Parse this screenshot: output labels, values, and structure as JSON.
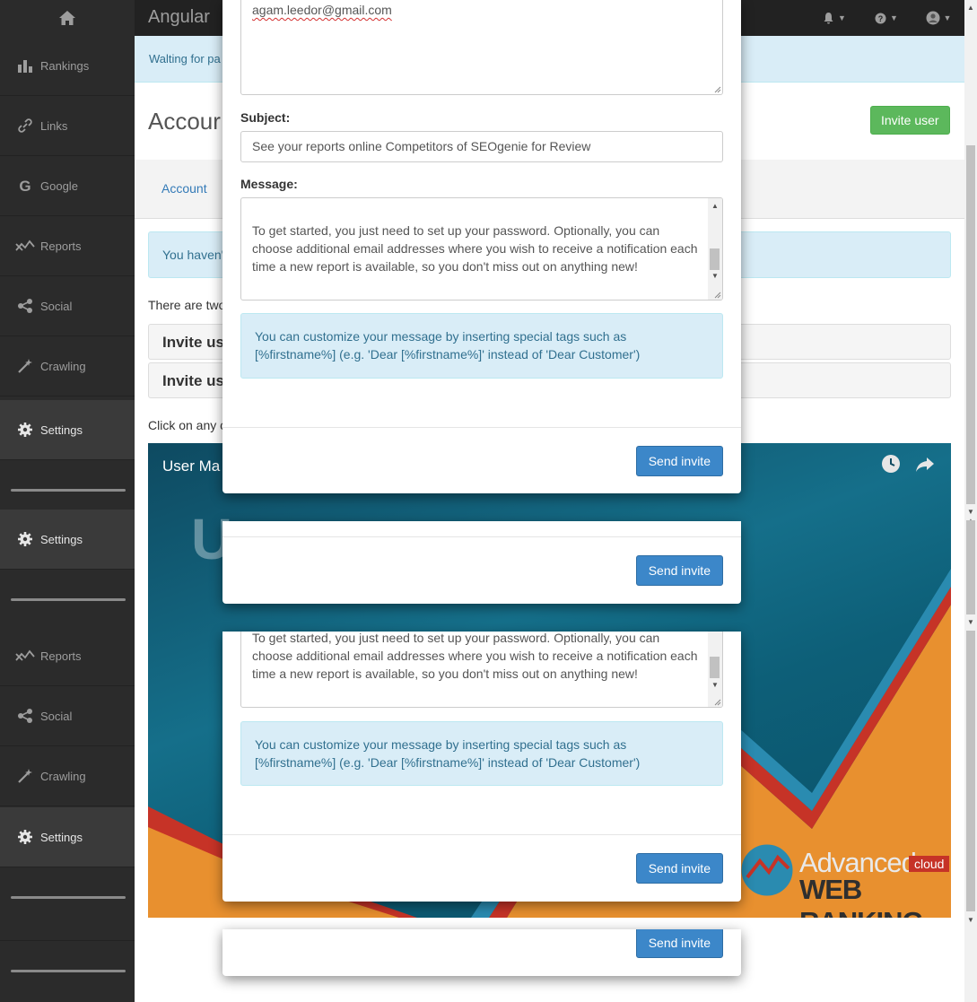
{
  "topbar": {
    "brand": "Angular"
  },
  "sidebar": {
    "items": [
      {
        "label": "Rankings",
        "icon": "bar-chart-icon"
      },
      {
        "label": "Links",
        "icon": "link-icon"
      },
      {
        "label": "Google",
        "icon": "google-icon"
      },
      {
        "label": "Reports",
        "icon": "reports-icon"
      },
      {
        "label": "Social",
        "icon": "share-icon"
      },
      {
        "label": "Crawling",
        "icon": "wand-icon"
      },
      {
        "label": "Settings",
        "icon": "gear-icon"
      },
      {
        "label": "Settings",
        "icon": "gear-icon"
      },
      {
        "label": "Reports",
        "icon": "reports-icon"
      },
      {
        "label": "Social",
        "icon": "share-icon"
      },
      {
        "label": "Crawling",
        "icon": "wand-icon"
      },
      {
        "label": "Settings",
        "icon": "gear-icon"
      }
    ]
  },
  "main": {
    "waiting_text": "Walting for pa",
    "page_title": "Accour",
    "invite_user_label": "Invite user",
    "tab_account": "Account",
    "info_text": "You haven'",
    "two_ways": "There are two",
    "panel1": "Invite us",
    "panel2": "Invite us",
    "click_any": "Click on any c",
    "video_title": "User Ma",
    "video_big": "U",
    "logo": {
      "advanced": "Advanced",
      "web_ranking": "WEB RANKING",
      "cloud": "cloud"
    }
  },
  "modal1": {
    "email": "agam.leedor@gmail.com",
    "subject_label": "Subject:",
    "subject_value": "See your reports online Competitors of SEOgenie for Review",
    "message_label": "Message:",
    "message_text": "To get started, you just need to set up your password. Optionally, you can choose additional email addresses where you wish to receive a notification each time a new report is available, so you don't miss out on anything new!",
    "hint": "You can customize your message by inserting special tags such as [%firstname%] (e.g. 'Dear [%firstname%]' instead of 'Dear Customer')",
    "send": "Send invite"
  },
  "modal2": {
    "send": "Send invite"
  },
  "modal3": {
    "message_text": "To get started, you just need to set up your password. Optionally, you can choose additional email addresses where you wish to receive a notification each time a new report is available, so you don't miss out on anything new!",
    "hint": "You can customize your message by inserting special tags such as [%firstname%] (e.g. 'Dear [%firstname%]' instead of 'Dear Customer')",
    "send": "Send invite"
  },
  "modal4": {
    "send": "Send invite"
  },
  "colors": {
    "primary": "#3c87c9",
    "success": "#5cb85c",
    "info_bg": "#d9edf7",
    "sidebar": "#2b2b2b"
  }
}
